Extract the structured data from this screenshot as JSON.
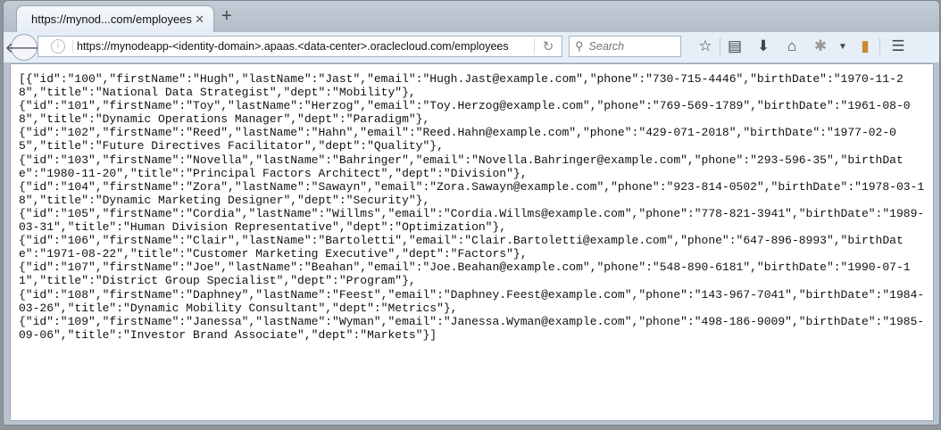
{
  "tab": {
    "title": "https://mynod...com/employees",
    "close": "✕",
    "new_tab": "+"
  },
  "nav": {
    "url": "https://mynodeapp-<identity-domain>.apaas.<data-center>.oraclecloud.com/employees",
    "search_placeholder": "Search"
  },
  "records": [
    "[{\"id\":\"100\",\"firstName\":\"Hugh\",\"lastName\":\"Jast\",\"email\":\"Hugh.Jast@example.com\",\"phone\":\"730-715-4446\",\"birthDate\":\"1970-11-28\",\"title\":\"National Data Strategist\",\"dept\":\"Mobility\"},",
    "{\"id\":\"101\",\"firstName\":\"Toy\",\"lastName\":\"Herzog\",\"email\":\"Toy.Herzog@example.com\",\"phone\":\"769-569-1789\",\"birthDate\":\"1961-08-08\",\"title\":\"Dynamic Operations Manager\",\"dept\":\"Paradigm\"},",
    "{\"id\":\"102\",\"firstName\":\"Reed\",\"lastName\":\"Hahn\",\"email\":\"Reed.Hahn@example.com\",\"phone\":\"429-071-2018\",\"birthDate\":\"1977-02-05\",\"title\":\"Future Directives Facilitator\",\"dept\":\"Quality\"},",
    "{\"id\":\"103\",\"firstName\":\"Novella\",\"lastName\":\"Bahringer\",\"email\":\"Novella.Bahringer@example.com\",\"phone\":\"293-596-35\",\"birthDate\":\"1980-11-20\",\"title\":\"Principal Factors Architect\",\"dept\":\"Division\"},",
    "{\"id\":\"104\",\"firstName\":\"Zora\",\"lastName\":\"Sawayn\",\"email\":\"Zora.Sawayn@example.com\",\"phone\":\"923-814-0502\",\"birthDate\":\"1978-03-18\",\"title\":\"Dynamic Marketing Designer\",\"dept\":\"Security\"},",
    "{\"id\":\"105\",\"firstName\":\"Cordia\",\"lastName\":\"Willms\",\"email\":\"Cordia.Willms@example.com\",\"phone\":\"778-821-3941\",\"birthDate\":\"1989-03-31\",\"title\":\"Human Division Representative\",\"dept\":\"Optimization\"},",
    "{\"id\":\"106\",\"firstName\":\"Clair\",\"lastName\":\"Bartoletti\",\"email\":\"Clair.Bartoletti@example.com\",\"phone\":\"647-896-8993\",\"birthDate\":\"1971-08-22\",\"title\":\"Customer Marketing Executive\",\"dept\":\"Factors\"},",
    "{\"id\":\"107\",\"firstName\":\"Joe\",\"lastName\":\"Beahan\",\"email\":\"Joe.Beahan@example.com\",\"phone\":\"548-890-6181\",\"birthDate\":\"1990-07-11\",\"title\":\"District Group Specialist\",\"dept\":\"Program\"},",
    "{\"id\":\"108\",\"firstName\":\"Daphney\",\"lastName\":\"Feest\",\"email\":\"Daphney.Feest@example.com\",\"phone\":\"143-967-7041\",\"birthDate\":\"1984-03-26\",\"title\":\"Dynamic Mobility Consultant\",\"dept\":\"Metrics\"},",
    "{\"id\":\"109\",\"firstName\":\"Janessa\",\"lastName\":\"Wyman\",\"email\":\"Janessa.Wyman@example.com\",\"phone\":\"498-186-9009\",\"birthDate\":\"1985-09-06\",\"title\":\"Investor Brand Associate\",\"dept\":\"Markets\"}]"
  ]
}
